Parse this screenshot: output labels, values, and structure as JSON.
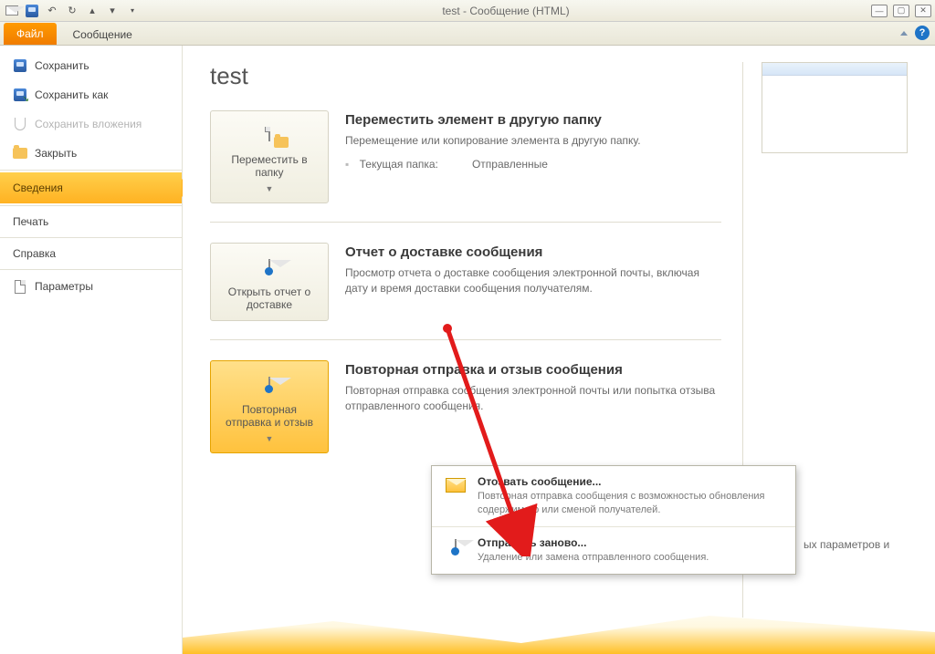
{
  "titlebar": {
    "title": "test  -  Сообщение (HTML)"
  },
  "tabs": {
    "file": "Файл",
    "message": "Сообщение"
  },
  "sidebar": {
    "save": "Сохранить",
    "save_as": "Сохранить как",
    "save_attachments": "Сохранить вложения",
    "close": "Закрыть",
    "info": "Сведения",
    "print": "Печать",
    "help": "Справка",
    "options": "Параметры"
  },
  "content": {
    "title": "test",
    "block1": {
      "button": "Переместить в папку",
      "title": "Переместить элемент в другую папку",
      "desc": "Перемещение или копирование элемента в другую папку.",
      "folder_label": "Текущая папка:",
      "folder_value": "Отправленные"
    },
    "block2": {
      "button": "Открыть отчет о доставке",
      "title": "Отчет о доставке сообщения",
      "desc": "Просмотр отчета о доставке сообщения электронной почты, включая дату и время доставки сообщения получателям."
    },
    "block3": {
      "button": "Повторная отправка и отзыв",
      "title": "Повторная отправка и отзыв сообщения",
      "desc": "Повторная отправка сообщения электронной почты или попытка отзыва отправленного сообщения."
    },
    "trailing": "ых параметров и"
  },
  "menu": {
    "item1": {
      "title": "Отозвать сообщение...",
      "desc": "Повторная отправка сообщения с возможностью обновления содержимого или сменой получателей."
    },
    "item2": {
      "title": "Отправить заново...",
      "desc": "Удаление или замена отправленного сообщения."
    }
  }
}
